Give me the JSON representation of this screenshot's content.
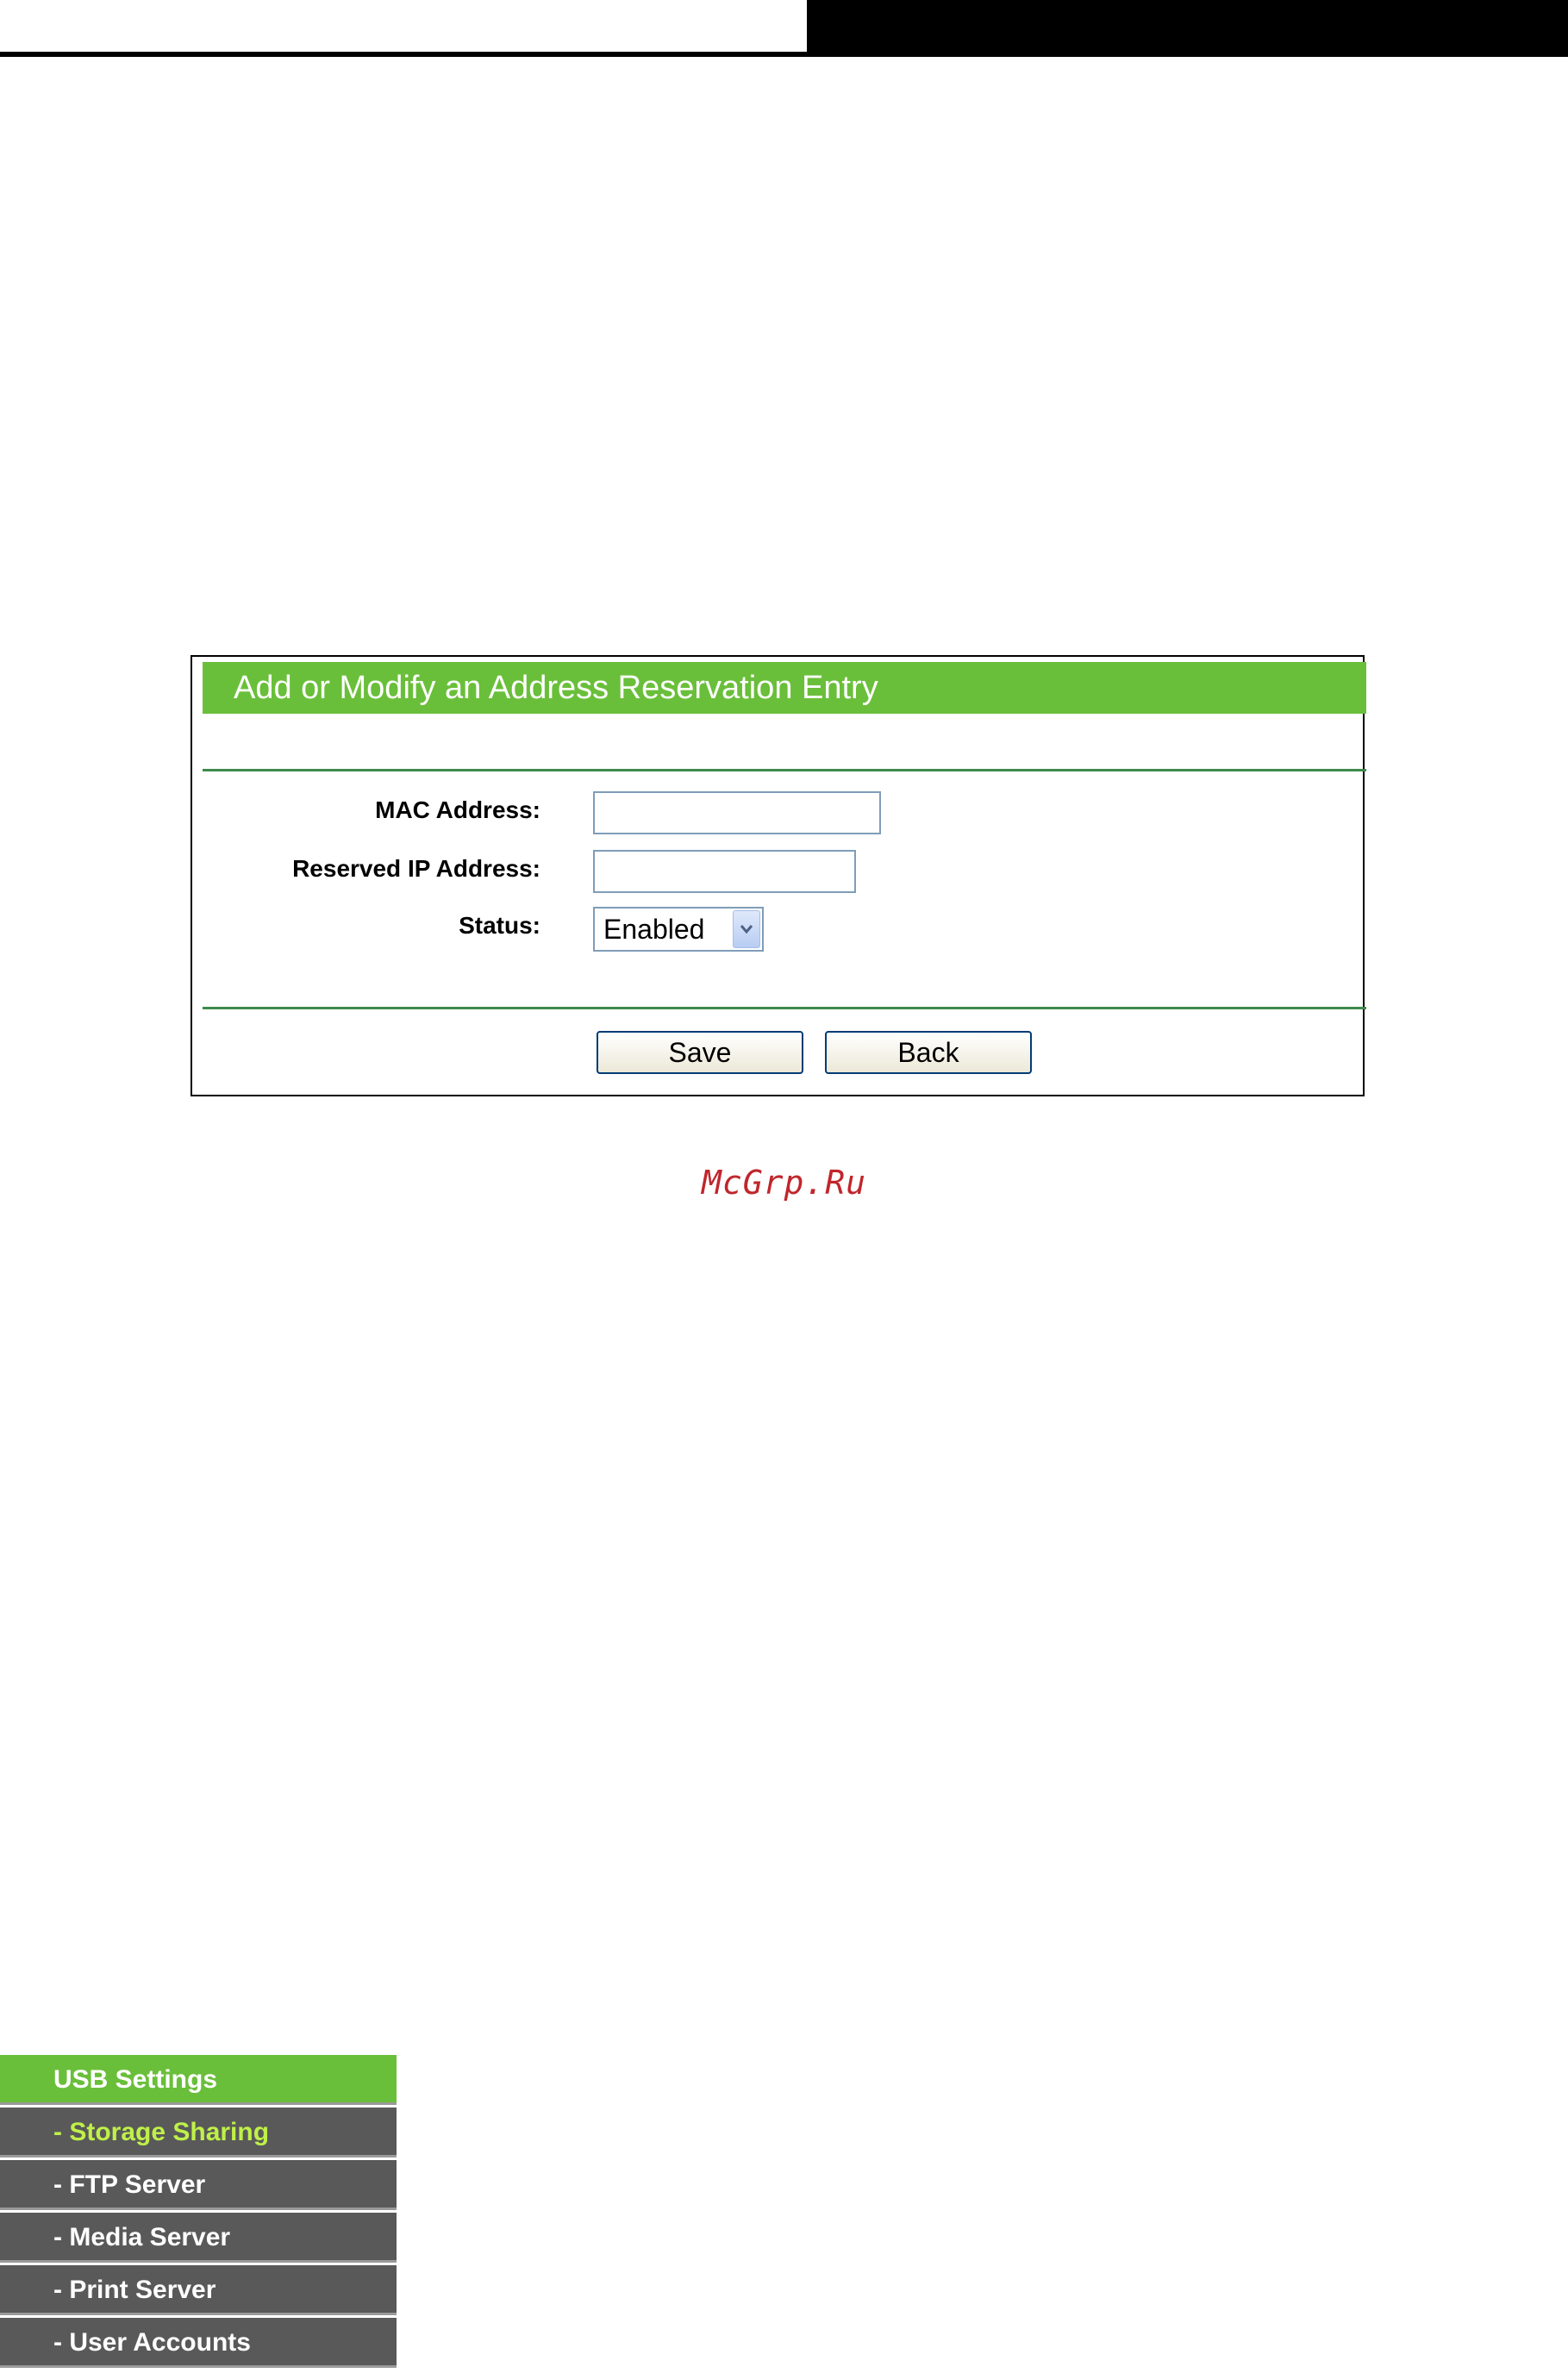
{
  "panel": {
    "title": "Add or Modify an Address Reservation Entry",
    "labels": {
      "mac": "MAC Address:",
      "ip": "Reserved IP Address:",
      "status": "Status:"
    },
    "inputs": {
      "mac_value": "",
      "ip_value": ""
    },
    "status_selected": "Enabled",
    "buttons": {
      "save": "Save",
      "back": "Back"
    }
  },
  "watermark": "McGrp.Ru",
  "menu": {
    "header": "USB Settings",
    "items": [
      {
        "label": "- Storage Sharing",
        "active": true
      },
      {
        "label": "- FTP Server",
        "active": false
      },
      {
        "label": "- Media Server",
        "active": false
      },
      {
        "label": "- Print Server",
        "active": false
      },
      {
        "label": "- User Accounts",
        "active": false
      }
    ]
  },
  "colors": {
    "title_green": "#6abf3a",
    "rule_green": "#3d8a4a",
    "menu_gray": "#595959",
    "menu_active_text": "#bff049",
    "watermark_red": "#c0262c"
  },
  "icons": {
    "select_arrow": "chevron-down-icon"
  }
}
